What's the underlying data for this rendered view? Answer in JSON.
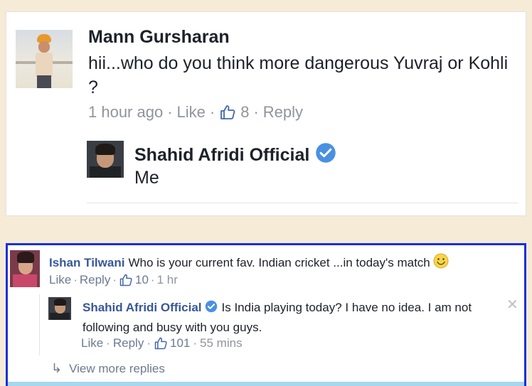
{
  "colors": {
    "page_background": "#f5ebd7",
    "highlight_border": "#1b2ee0",
    "name_link": "#365899",
    "meta_gray": "#90949c",
    "verified_badge": "#4a90e2"
  },
  "top_thread": {
    "comment": {
      "author": "Mann Gursharan",
      "text": "hii...who do you think  more dangerous Yuvraj or Kohli ?",
      "time": "1 hour ago",
      "like_label": "Like",
      "like_icon": "thumbs-up-icon",
      "like_count": "8",
      "reply_label": "Reply"
    },
    "reply": {
      "author": "Shahid Afridi Official",
      "verified_icon": "verified-badge-icon",
      "text": "Me"
    }
  },
  "bottom_thread": {
    "comment": {
      "author": "Ishan Tilwani",
      "text": "Who is your current fav. Indian cricket ...in today's match",
      "emoji_icon": "smiley-icon",
      "like_label": "Like",
      "reply_label": "Reply",
      "like_count": "10",
      "time": "1 hr"
    },
    "reply": {
      "author": "Shahid Afridi Official",
      "verified_icon": "verified-badge-icon",
      "text": "Is India playing today? I have no idea. I am not following and busy with you guys.",
      "like_label": "Like",
      "reply_label": "Reply",
      "like_count": "101",
      "time": "55 mins",
      "close_icon": "close-icon"
    },
    "view_more": {
      "icon": "reply-arrow-icon",
      "label": "View more replies"
    }
  }
}
